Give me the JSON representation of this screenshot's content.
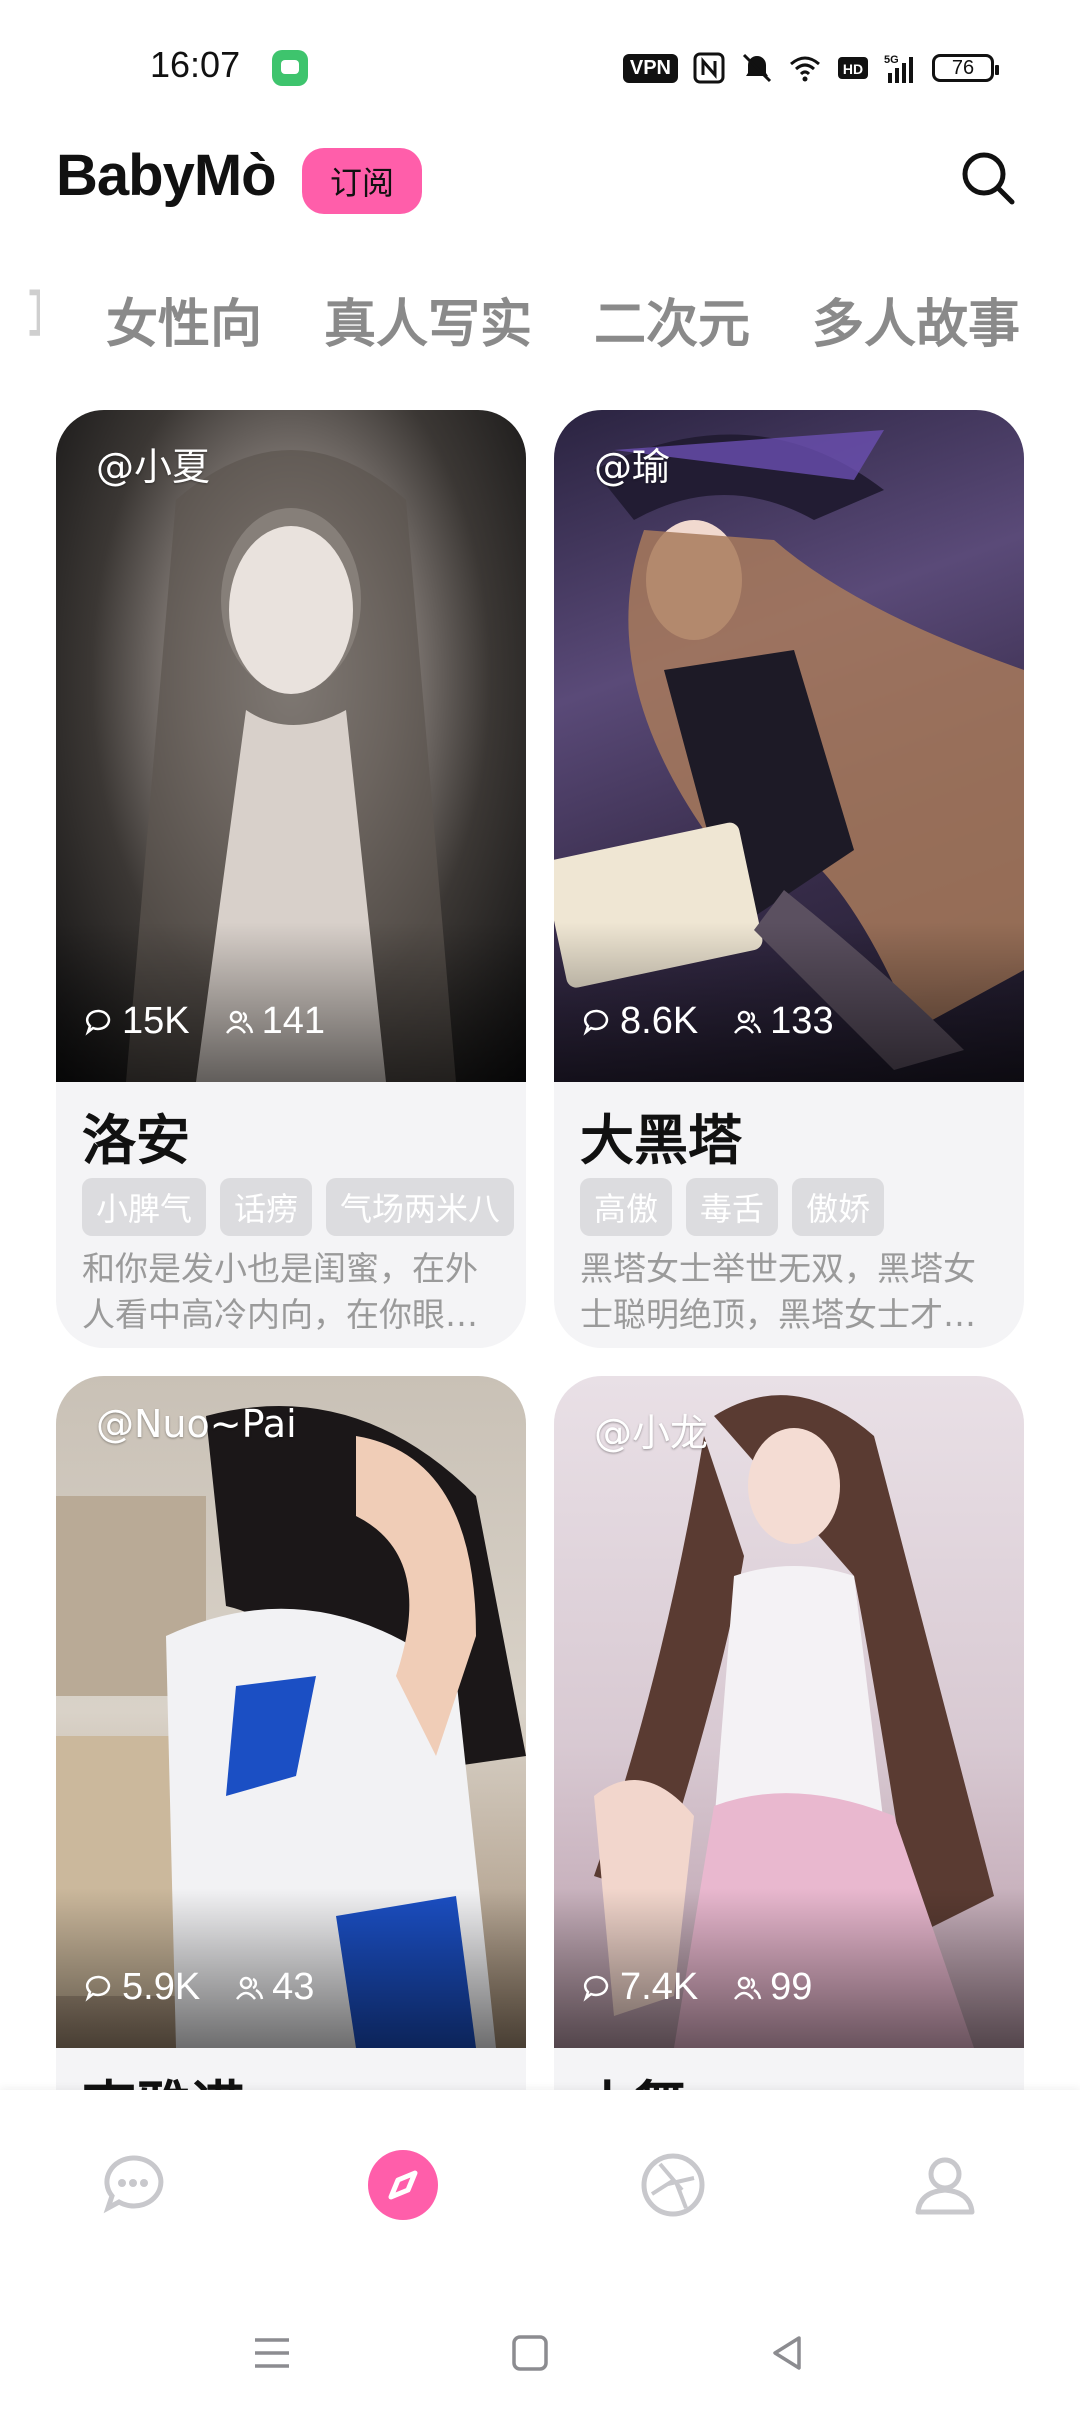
{
  "status_bar": {
    "time": "16:07",
    "vpn": "VPN",
    "battery": "76"
  },
  "header": {
    "logo": "BabyMò",
    "subscribe_label": "订阅"
  },
  "tabs": [
    "女性向",
    "真人写实",
    "二次元",
    "多人故事"
  ],
  "cards": [
    {
      "handle": "@小夏",
      "comments": "15K",
      "users": "141",
      "name": "洛安",
      "tags": [
        "小脾气",
        "话痨",
        "气场两米八"
      ],
      "desc": "和你是发小也是闺蜜，在外人看中高冷内向，在你眼…"
    },
    {
      "handle": "@瑜",
      "comments": "8.6K",
      "users": "133",
      "name": "大黑塔",
      "tags": [
        "高傲",
        "毒舌",
        "傲娇"
      ],
      "desc": "黑塔女士举世无双，黑塔女士聪明绝顶，黑塔女士才…"
    },
    {
      "handle": "@Nuo~Pai",
      "comments": "5.9K",
      "users": "43",
      "name": "李雅诺"
    },
    {
      "handle": "@小龙",
      "comments": "7.4K",
      "users": "99",
      "name": "小舞"
    }
  ],
  "bottom_nav": [
    "chat-bubble-icon",
    "discover-compass-icon",
    "aperture-icon",
    "profile-icon"
  ]
}
